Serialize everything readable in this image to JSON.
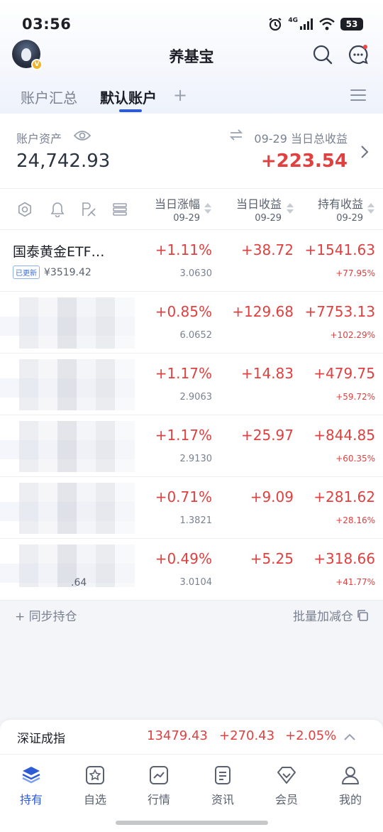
{
  "status_bar": {
    "time": "03:56",
    "network": "4G",
    "battery": "53"
  },
  "header": {
    "title": "养基宝"
  },
  "tabs": [
    {
      "label": "账户汇总"
    },
    {
      "label": "默认账户"
    }
  ],
  "summary": {
    "asset_label": "账户资产",
    "asset_value": "24,742.93",
    "daily_label": "09-29 当日总收益",
    "daily_value": "+223.54"
  },
  "columns": [
    {
      "title": "当日涨幅",
      "date": "09-29"
    },
    {
      "title": "当日收益",
      "date": "09-29"
    },
    {
      "title": "持有收益",
      "date": "09-29"
    }
  ],
  "toolbar_icons": [
    "settings-icon",
    "bell-icon",
    "rk-icon",
    "list-icon"
  ],
  "funds": [
    {
      "name": "国泰黄金ETF…",
      "badge": "已更新",
      "amount": "¥3519.42",
      "pct": "+1.11%",
      "nav": "3.0630",
      "daily": "+38.72",
      "hold": "+1541.63",
      "hold_pct": "+77.95%"
    },
    {
      "name": "",
      "badge": "",
      "amount": "",
      "pct": "+0.85%",
      "nav": "6.0652",
      "daily": "+129.68",
      "hold": "+7753.13",
      "hold_pct": "+102.29%"
    },
    {
      "name": "",
      "badge": "",
      "amount": "",
      "pct": "+1.17%",
      "nav": "2.9063",
      "daily": "+14.83",
      "hold": "+479.75",
      "hold_pct": "+59.72%"
    },
    {
      "name": "",
      "badge": "",
      "amount": "",
      "pct": "+1.17%",
      "nav": "2.9130",
      "daily": "+25.97",
      "hold": "+844.85",
      "hold_pct": "+60.35%"
    },
    {
      "name": "",
      "badge": "",
      "amount": "",
      "pct": "+0.71%",
      "nav": "1.3821",
      "daily": "+9.09",
      "hold": "+281.62",
      "hold_pct": "+28.16%"
    },
    {
      "name": "",
      "badge": "",
      "amount": ".64",
      "pct": "+0.49%",
      "nav": "3.0104",
      "daily": "+5.25",
      "hold": "+318.66",
      "hold_pct": "+41.77%"
    }
  ],
  "footer": {
    "sync_label": "+ 同步持仓",
    "batch_label": "批量加减仓"
  },
  "index_bar": {
    "name": "深证成指",
    "value": "13479.43",
    "change": "+270.43",
    "change_pct": "+2.05%"
  },
  "nav_tabs": [
    {
      "label": "持有",
      "icon": "layers-icon"
    },
    {
      "label": "自选",
      "icon": "star-icon"
    },
    {
      "label": "行情",
      "icon": "chart-icon"
    },
    {
      "label": "资讯",
      "icon": "news-icon"
    },
    {
      "label": "会员",
      "icon": "diamond-icon"
    },
    {
      "label": "我的",
      "icon": "user-icon"
    }
  ],
  "colors": {
    "accent": "#2f5bd6",
    "positive": "#e04040",
    "text": "#1c1f26",
    "muted": "#7a8191"
  }
}
